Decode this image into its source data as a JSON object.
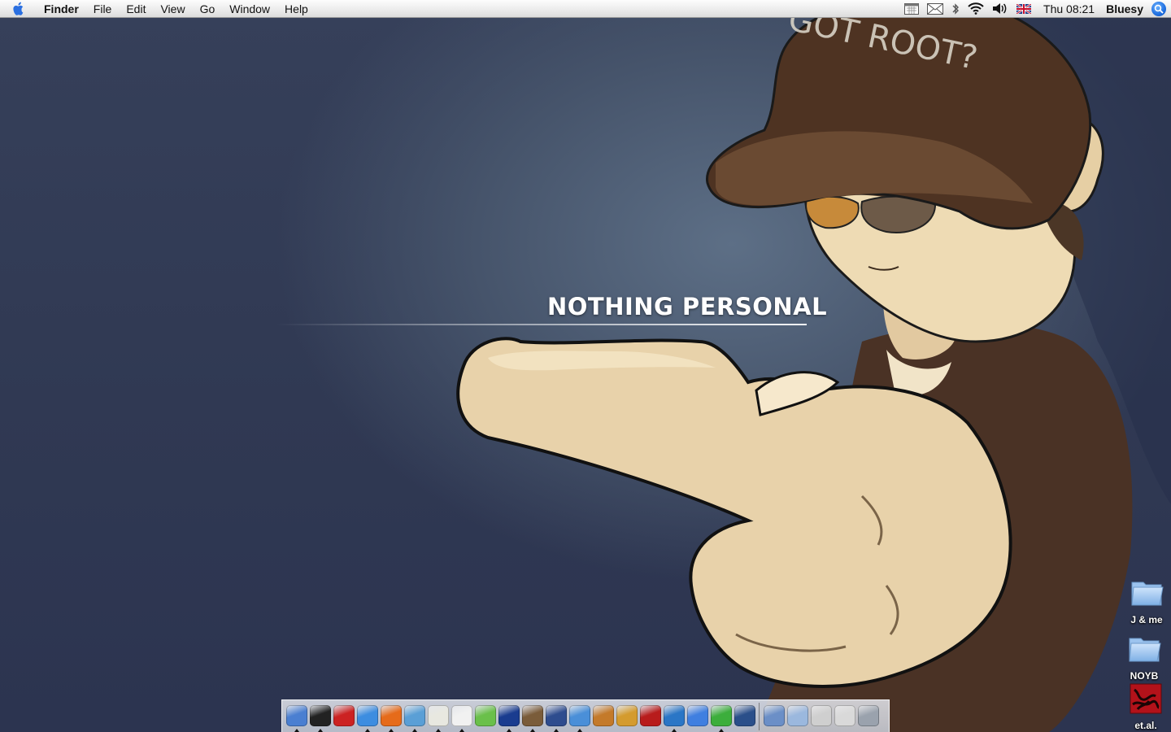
{
  "menubar": {
    "app_name": "Finder",
    "menus": [
      "File",
      "Edit",
      "View",
      "Go",
      "Window",
      "Help"
    ],
    "clock": "Thu 08:21",
    "user": "Bluesy",
    "tray_icons": [
      "calendar-icon",
      "mail-icon",
      "bluetooth-icon",
      "wifi-icon",
      "volume-icon",
      "flag-uk-icon"
    ]
  },
  "wallpaper": {
    "tagline": "NOTHING PERSONAL",
    "cap_text": "GOT ROOT?"
  },
  "desktop_icons": [
    {
      "label": "J & me",
      "icon": "folder-icon"
    },
    {
      "label": "NOYB",
      "icon": "folder-icon"
    },
    {
      "label": "et.al.",
      "icon": "image-icon"
    }
  ],
  "dock": {
    "apps": [
      {
        "name": "finder",
        "color": "#4a7fd1"
      },
      {
        "name": "dashboard",
        "color": "#222222"
      },
      {
        "name": "fire-extinguisher",
        "color": "#cc2222"
      },
      {
        "name": "safari",
        "color": "#3d8de0"
      },
      {
        "name": "firefox",
        "color": "#e66b1a"
      },
      {
        "name": "feather",
        "color": "#5a9fd6"
      },
      {
        "name": "notes",
        "color": "#e8e8e0"
      },
      {
        "name": "ical",
        "color": "#f1f1f1"
      },
      {
        "name": "itunes",
        "color": "#6ac04a"
      },
      {
        "name": "exclamation",
        "color": "#1a3c8f"
      },
      {
        "name": "iphoto",
        "color": "#7a5c3a"
      },
      {
        "name": "imovie",
        "color": "#2e4c8e"
      },
      {
        "name": "idvd",
        "color": "#4a8fd8"
      },
      {
        "name": "garageband",
        "color": "#c47a2a"
      },
      {
        "name": "slides",
        "color": "#d49b2e"
      },
      {
        "name": "photobooth",
        "color": "#b81c1c"
      },
      {
        "name": "preview",
        "color": "#2a76c6"
      },
      {
        "name": "ichat",
        "color": "#3f7fe0"
      },
      {
        "name": "xcode",
        "color": "#3cae3c"
      },
      {
        "name": "car",
        "color": "#2a4f8a"
      }
    ],
    "docs": [
      {
        "name": "applications-stack",
        "color": "#6b8fc7"
      },
      {
        "name": "documents-stack",
        "color": "#9bb8de"
      },
      {
        "name": "keyboard",
        "color": "#cfcfcf"
      },
      {
        "name": "downloads-stack",
        "color": "#d9d9d9"
      },
      {
        "name": "trash",
        "color": "#9aa2ad"
      }
    ]
  }
}
